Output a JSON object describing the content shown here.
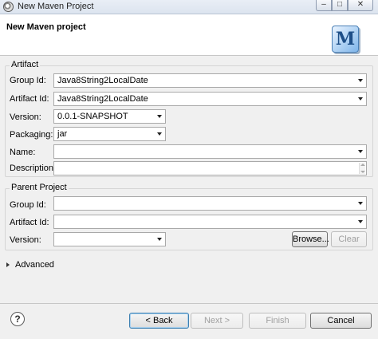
{
  "window": {
    "title": "New Maven Project",
    "controls": {
      "minimize": "–",
      "maximize": "□",
      "close": "✕"
    }
  },
  "header": {
    "title": "New Maven project",
    "logo_letter": "M"
  },
  "artifact": {
    "legend": "Artifact",
    "group_id": {
      "label": "Group Id:",
      "value": "Java8String2LocalDate"
    },
    "artifact_id": {
      "label": "Artifact Id:",
      "value": "Java8String2LocalDate"
    },
    "version": {
      "label": "Version:",
      "value": "0.0.1-SNAPSHOT"
    },
    "packaging": {
      "label": "Packaging:",
      "value": "jar"
    },
    "name": {
      "label": "Name:",
      "value": ""
    },
    "description": {
      "label": "Description:",
      "value": ""
    }
  },
  "parent": {
    "legend": "Parent Project",
    "group_id": {
      "label": "Group Id:",
      "value": ""
    },
    "artifact_id": {
      "label": "Artifact Id:",
      "value": ""
    },
    "version": {
      "label": "Version:",
      "value": ""
    },
    "browse_label": "Browse...",
    "clear_label": "Clear"
  },
  "advanced": {
    "label": "Advanced"
  },
  "footer": {
    "help_glyph": "?",
    "back_label": "< Back",
    "next_label": "Next >",
    "finish_label": "Finish",
    "cancel_label": "Cancel"
  }
}
